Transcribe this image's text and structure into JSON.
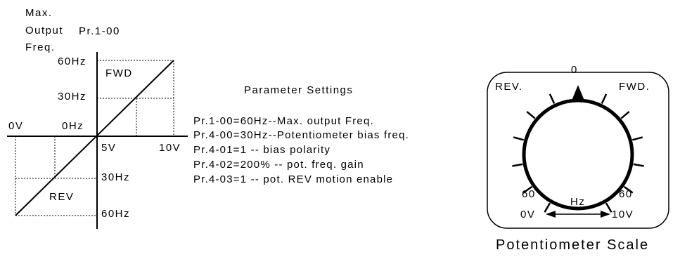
{
  "graph": {
    "y_title": [
      "Max.",
      "Output",
      "Freq."
    ],
    "y_title_param": "Pr.1-00",
    "top_freq": "60Hz",
    "mid_freq": "30Hz",
    "zero_freq": "0Hz",
    "neg_mid_freq": "30Hz",
    "neg_top_freq": "60Hz",
    "fwd": "FWD",
    "rev": "REV",
    "left_volt": "0V",
    "center_volt": "5V",
    "right_volt": "10V"
  },
  "settings": {
    "title": "Parameter Settings",
    "lines": [
      "Pr.1-00=60Hz--Max. output Freq.",
      "Pr.4-00=30Hz--Potentiometer bias freq.",
      "Pr.4-01=1 -- bias polarity",
      "Pr.4-02=200% -- pot. freq. gain",
      "Pr.4-03=1 -- pot. REV motion enable"
    ]
  },
  "knob": {
    "zero": "0",
    "rev": "REV.",
    "fwd": "FWD.",
    "left_max": "60",
    "right_max": "60",
    "unit": "Hz",
    "left_volt": "0V",
    "right_volt": "10V"
  },
  "scale_title": "Potentiometer Scale"
}
